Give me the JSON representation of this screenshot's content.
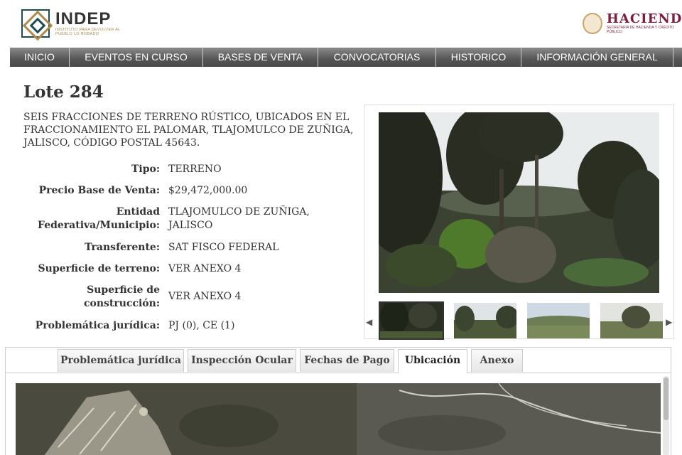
{
  "header": {
    "logo_name": "INDEP",
    "logo_tagline": "INSTITUTO PARA DEVOLVER AL PUEBLO LO ROBADO",
    "partner_name": "HACIEND",
    "partner_sub": "SECRETARÍA DE HACIENDA Y CRÉDITO PÚBLICO"
  },
  "nav": [
    "INICIO",
    "EVENTOS EN CURSO",
    "BASES DE VENTA",
    "CONVOCATORIAS",
    "HISTORICO",
    "INFORMACIÓN GENERAL"
  ],
  "lot": {
    "title": "Lote 284",
    "description": "SEIS FRACCIONES DE TERRENO RÚSTICO, UBICADOS EN EL FRACCIONAMIENTO EL PALOMAR, TLAJOMULCO DE ZUÑIGA, JALISCO, CÓDIGO POSTAL 45643.",
    "fields": [
      {
        "label": "Tipo:",
        "value": "TERRENO"
      },
      {
        "label": "Precio Base de Venta:",
        "value": "$29,472,000.00"
      },
      {
        "label": "Entidad Federativa/Municipio:",
        "value": "TLAJOMULCO DE ZUÑIGA, JALISCO"
      },
      {
        "label": "Transferente:",
        "value": "SAT FISCO FEDERAL"
      },
      {
        "label": "Superficie de terreno:",
        "value": "VER ANEXO 4"
      },
      {
        "label": "Superficie de construcción:",
        "value": "VER ANEXO 4"
      },
      {
        "label": "Problemática jurídica:",
        "value": "PJ (0), CE (1)"
      }
    ]
  },
  "gallery": {
    "prev_arrow": "◀",
    "next_arrow": "▶"
  },
  "tabs": [
    "Problemática jurídica",
    "Inspección Ocular",
    "Fechas de Pago",
    "Ubicación",
    "Anexo"
  ],
  "active_tab": "Ubicación",
  "colors": {
    "nav_bg": "#555555",
    "partner": "#7a1f3d",
    "logo_accent": "#b08a4a"
  }
}
